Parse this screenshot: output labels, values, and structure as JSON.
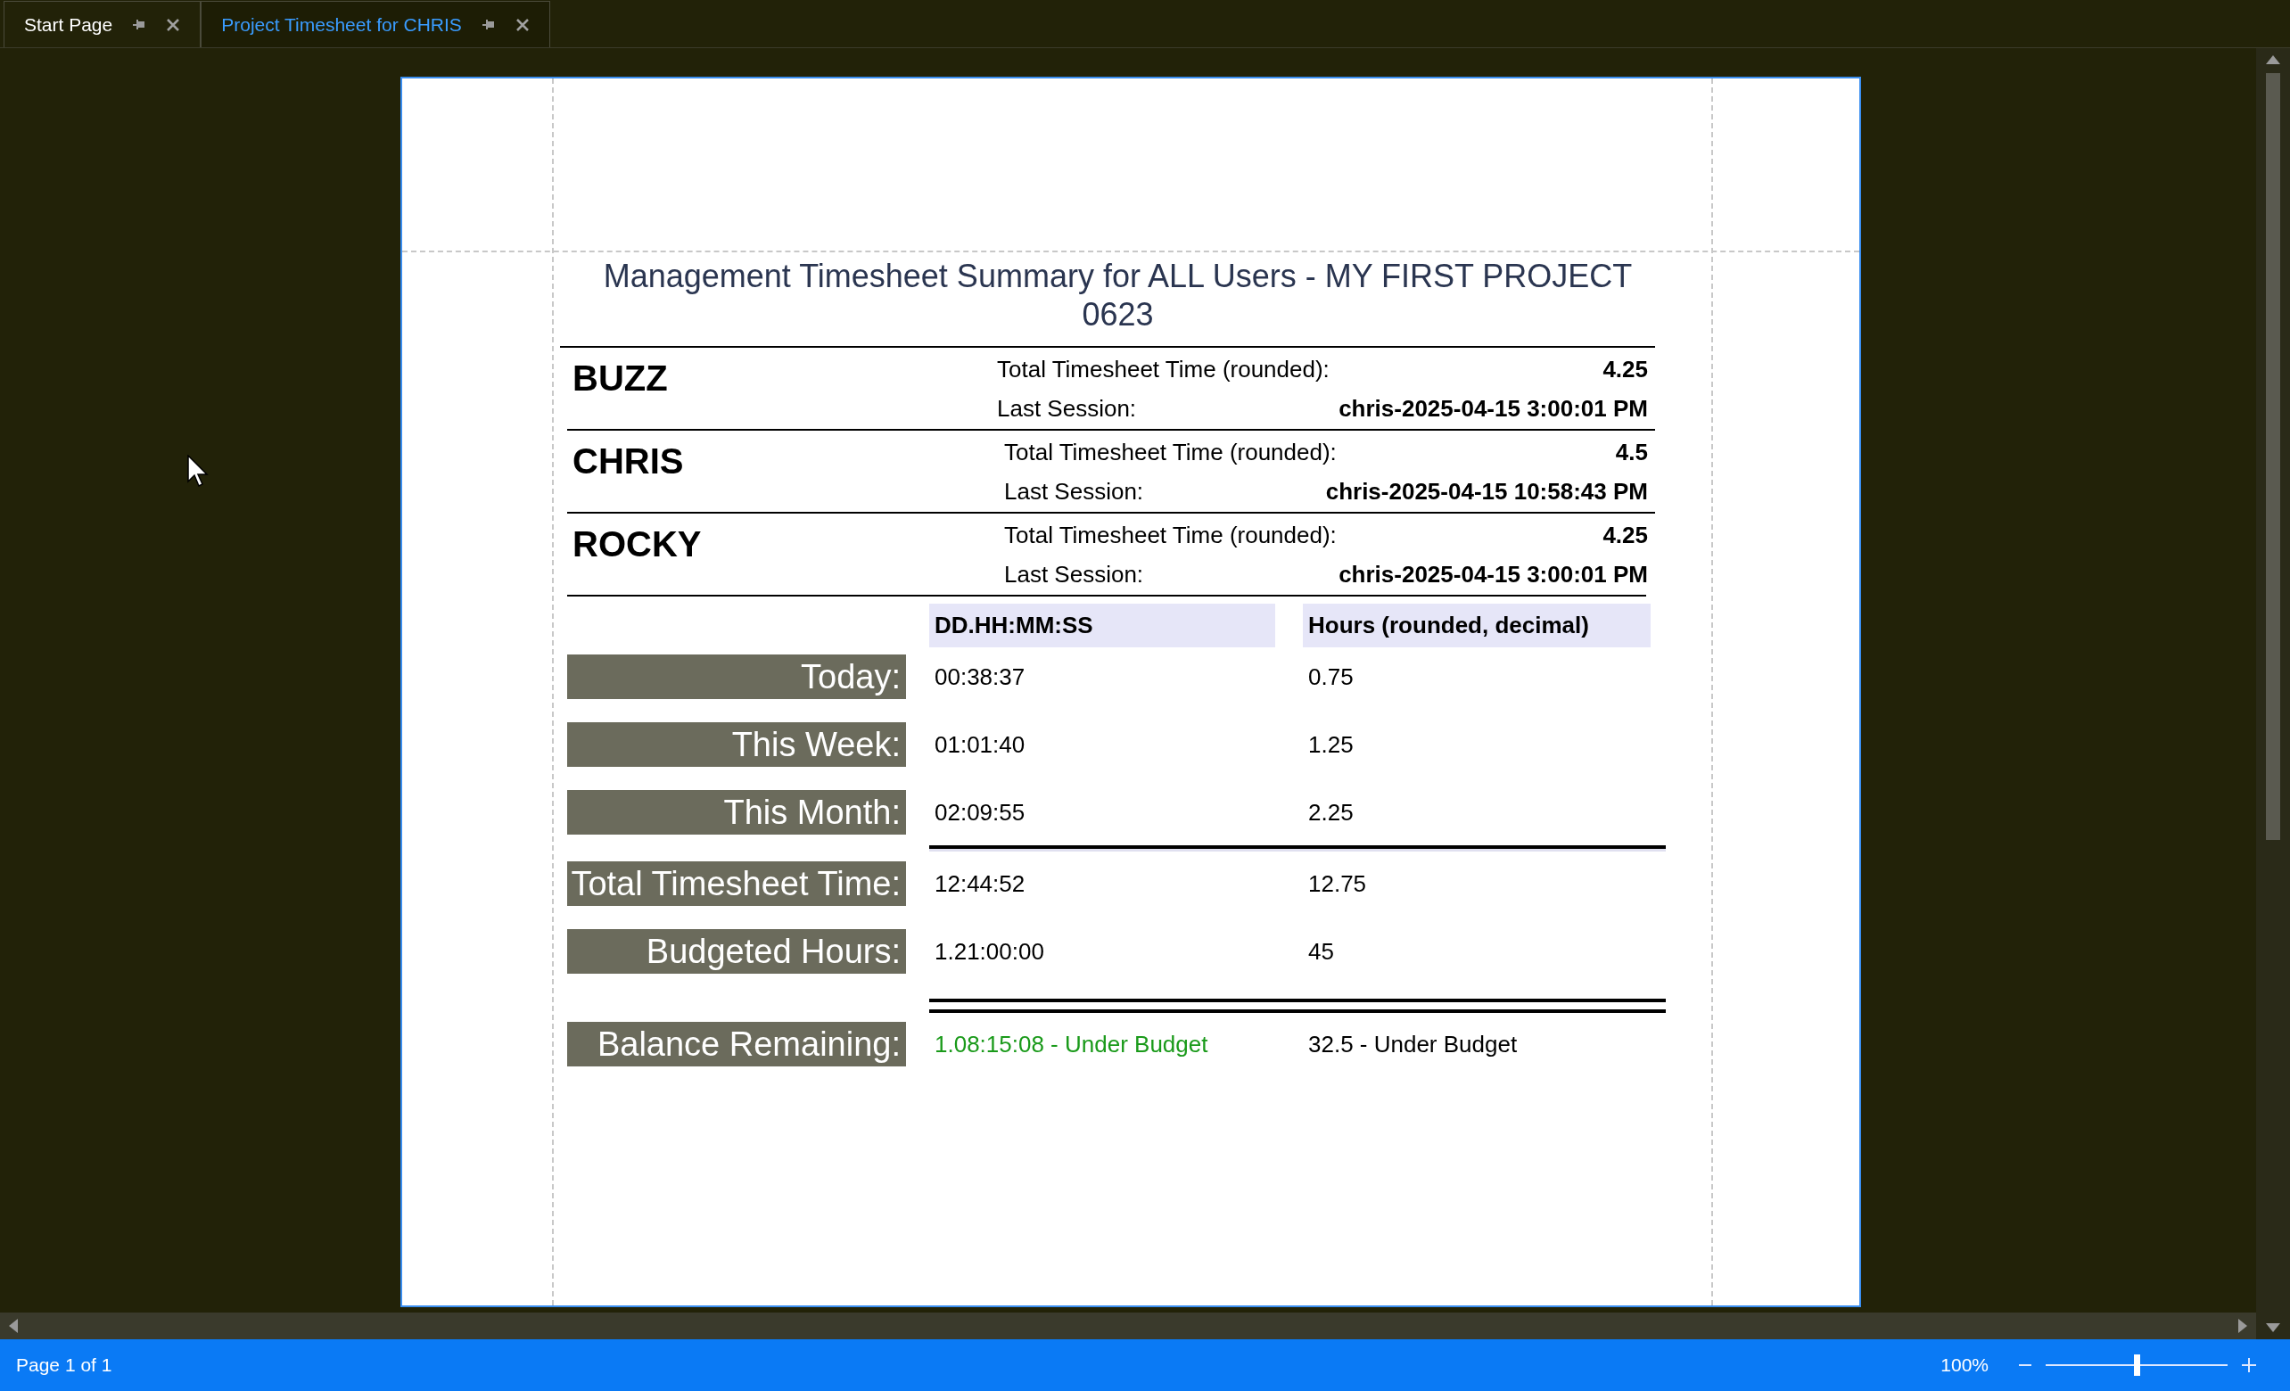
{
  "tabs": [
    {
      "label": "Start Page",
      "selected": false
    },
    {
      "label": "Project Timesheet for CHRIS",
      "selected": true
    }
  ],
  "report": {
    "title": "Management Timesheet Summary for ALL Users - MY FIRST PROJECT 0623",
    "users": [
      {
        "name": "BUZZ",
        "total_label": "Total Timesheet Time (rounded):",
        "total": "4.25",
        "session_label": "Last Session:",
        "session": "chris-2025-04-15 3:00:01 PM"
      },
      {
        "name": "CHRIS",
        "total_label": "Total Timesheet Time (rounded):",
        "total": "4.5",
        "session_label": "Last Session:",
        "session": "chris-2025-04-15 10:58:43 PM"
      },
      {
        "name": "ROCKY",
        "total_label": "Total Timesheet Time (rounded):",
        "total": "4.25",
        "session_label": "Last Session:",
        "session": "chris-2025-04-15 3:00:01 PM"
      }
    ],
    "columns": [
      "DD.HH:MM:SS",
      "Hours (rounded, decimal)"
    ],
    "rows": [
      {
        "label": "Today:",
        "duration": "00:38:37",
        "hours": "0.75"
      },
      {
        "label": "This Week:",
        "duration": "01:01:40",
        "hours": "1.25"
      },
      {
        "label": "This Month:",
        "duration": "02:09:55",
        "hours": "2.25"
      },
      {
        "label": "Total Timesheet Time:",
        "duration": "12:44:52",
        "hours": "12.75",
        "rule_above": true,
        "rule_double": false
      },
      {
        "label": "Budgeted Hours:",
        "duration": "1.21:00:00",
        "hours": "45"
      },
      {
        "label": "Balance Remaining:",
        "duration": "1.08:15:08 - Under Budget",
        "hours": "32.5 - Under Budget",
        "rule_above": true,
        "rule_double": true,
        "color": "#1a9a1a"
      }
    ]
  },
  "status_bar": {
    "page": "Page 1 of 1",
    "zoom": "100%",
    "level": 0.5
  }
}
